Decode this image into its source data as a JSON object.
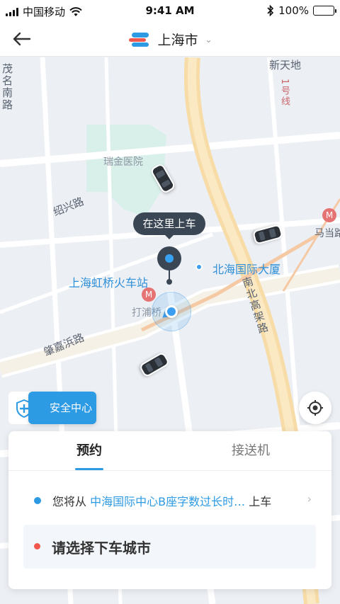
{
  "status_bar": {
    "carrier": "中国移动",
    "time": "9:41 AM",
    "battery": "100%"
  },
  "nav": {
    "city": "上海市"
  },
  "map": {
    "streets": [
      "茂名南路",
      "新天地",
      "1号线",
      "瑞金医院",
      "绍兴路",
      "马当路",
      "南北高架路",
      "肇嘉浜路",
      "打浦桥"
    ],
    "pickup_tooltip": "在这里上车",
    "poi_pickup": "上海虹桥火车站",
    "poi_other": "北海国际大厦"
  },
  "safety": {
    "label": "安全中心"
  },
  "panel": {
    "tabs": [
      "预约",
      "接送机"
    ],
    "pickup_prefix": "您将从",
    "pickup_address": "中海国际中心B座字数过长时…",
    "pickup_suffix": "上车",
    "destination_prompt": "请选择下车城市"
  },
  "colors": {
    "accent": "#2d9ae4",
    "destination_dot": "#f0574d",
    "pin": "#3a4654"
  }
}
